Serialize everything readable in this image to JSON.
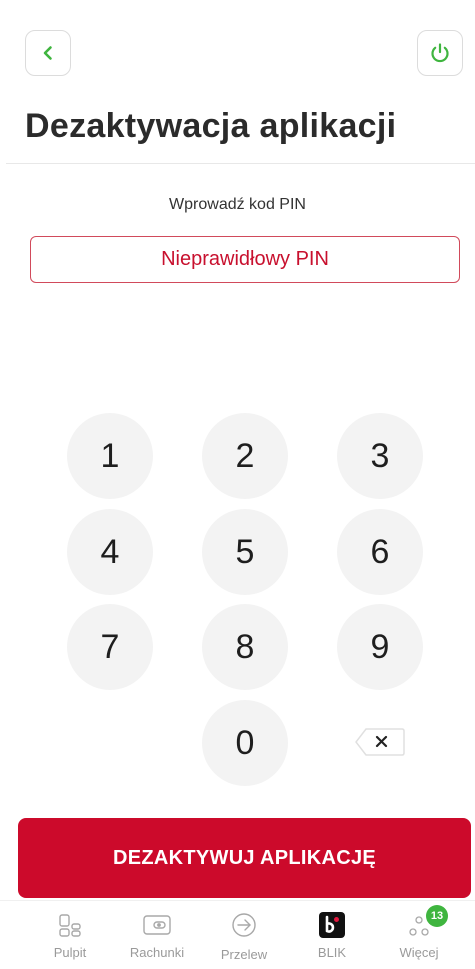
{
  "header": {
    "title": "Dezaktywacja aplikacji",
    "back_icon": "chevron-left-icon",
    "power_icon": "power-icon",
    "accent_color": "#3fb53f"
  },
  "pin": {
    "prompt": "Wprowadź kod PIN",
    "error_message": "Nieprawidłowy PIN",
    "error_color": "#c8102e"
  },
  "keypad": {
    "k1": "1",
    "k2": "2",
    "k3": "3",
    "k4": "4",
    "k5": "5",
    "k6": "6",
    "k7": "7",
    "k8": "8",
    "k9": "9",
    "k0": "0",
    "backspace_icon": "backspace-icon"
  },
  "actions": {
    "deactivate_label": "DEZAKTYWUJ APLIKACJĘ",
    "button_color": "#cc0a2b"
  },
  "bottom_nav": {
    "items": [
      {
        "label": "Pulpit",
        "icon": "dashboard-icon"
      },
      {
        "label": "Rachunki",
        "icon": "wallet-icon"
      },
      {
        "label": "Przelew",
        "icon": "transfer-icon"
      },
      {
        "label": "BLIK",
        "icon": "blik-icon"
      },
      {
        "label": "Więcej",
        "icon": "more-icon",
        "badge": "13"
      }
    ]
  }
}
